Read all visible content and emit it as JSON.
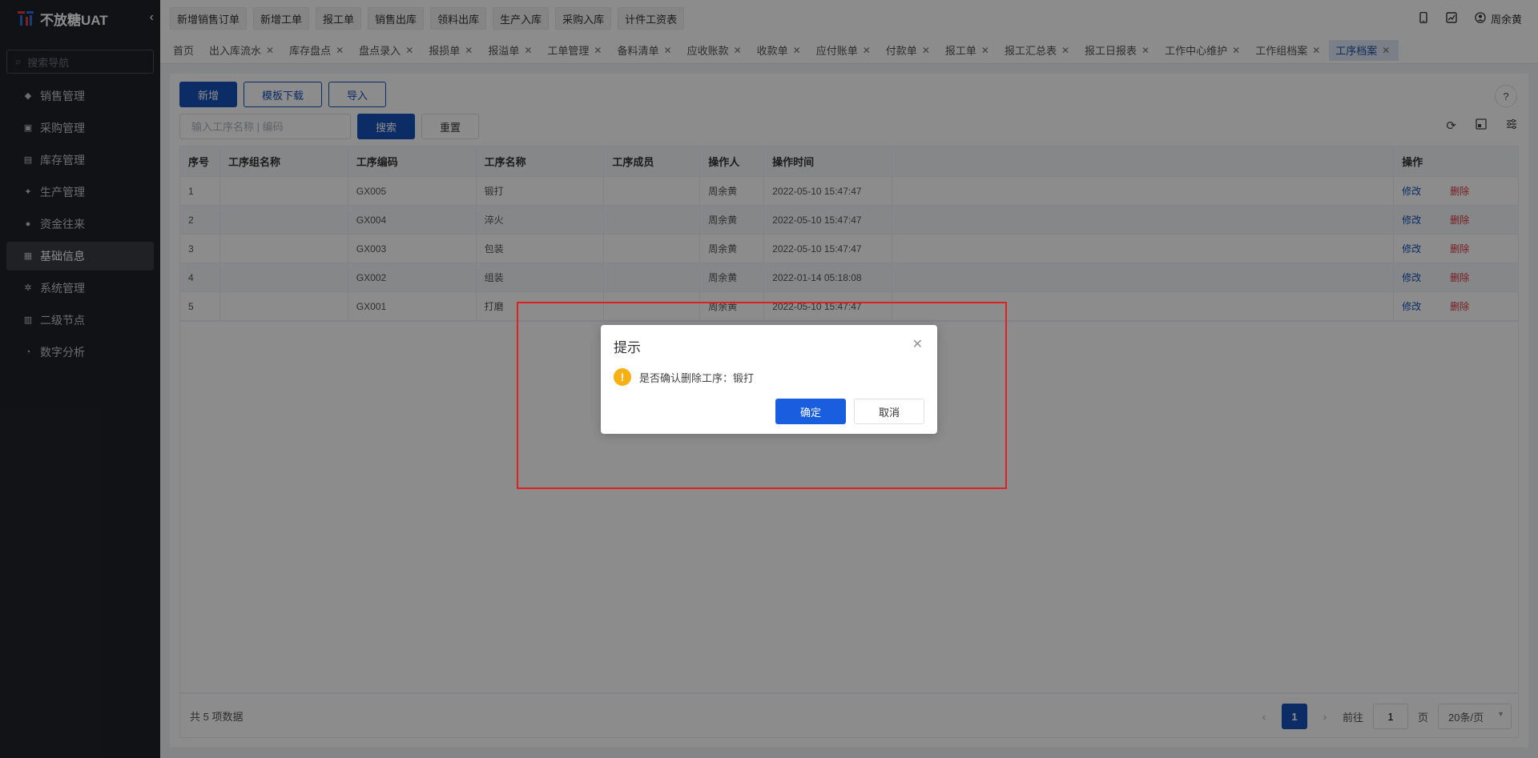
{
  "app": {
    "title": "不放糖UAT",
    "collapse_icon": "chevron-left-icon"
  },
  "sidebar": {
    "search_placeholder": "搜索导航",
    "items": [
      {
        "label": "销售管理",
        "icon": "tag-icon"
      },
      {
        "label": "采购管理",
        "icon": "cart-icon"
      },
      {
        "label": "库存管理",
        "icon": "warehouse-icon"
      },
      {
        "label": "生产管理",
        "icon": "production-icon"
      },
      {
        "label": "资金往来",
        "icon": "money-icon"
      },
      {
        "label": "基础信息",
        "icon": "grid-icon",
        "active": true
      },
      {
        "label": "系统管理",
        "icon": "settings-icon"
      },
      {
        "label": "二级节点",
        "icon": "document-icon"
      },
      {
        "label": "数字分析",
        "icon": "pie-chart-icon"
      }
    ]
  },
  "topbar": {
    "quick_buttons": [
      "新增销售订单",
      "新增工单",
      "报工单",
      "销售出库",
      "领料出库",
      "生产入库",
      "采购入库",
      "计件工资表"
    ],
    "user_name": "周余黄"
  },
  "tabs": [
    {
      "label": "首页",
      "closable": false
    },
    {
      "label": "出入库流水",
      "closable": true
    },
    {
      "label": "库存盘点",
      "closable": true
    },
    {
      "label": "盘点录入",
      "closable": true
    },
    {
      "label": "报损单",
      "closable": true
    },
    {
      "label": "报溢单",
      "closable": true
    },
    {
      "label": "工单管理",
      "closable": true
    },
    {
      "label": "备料清单",
      "closable": true
    },
    {
      "label": "应收账款",
      "closable": true
    },
    {
      "label": "收款单",
      "closable": true
    },
    {
      "label": "应付账单",
      "closable": true
    },
    {
      "label": "付款单",
      "closable": true
    },
    {
      "label": "报工单",
      "closable": true
    },
    {
      "label": "报工汇总表",
      "closable": true
    },
    {
      "label": "报工日报表",
      "closable": true
    },
    {
      "label": "工作中心维护",
      "closable": true
    },
    {
      "label": "工作组档案",
      "closable": true
    },
    {
      "label": "工序档案",
      "closable": true,
      "active": true
    }
  ],
  "toolbar": {
    "add_label": "新增",
    "template_label": "模板下载",
    "import_label": "导入",
    "search_placeholder": "输入工序名称 | 编码",
    "search_label": "搜索",
    "reset_label": "重置"
  },
  "table": {
    "headers": [
      "序号",
      "工序组名称",
      "工序编码",
      "工序名称",
      "工序成员",
      "操作人",
      "操作时间",
      "",
      "操作"
    ],
    "rows": [
      {
        "no": "1",
        "group": "",
        "code": "GX005",
        "name": "锻打",
        "members": "",
        "operator": "周余黄",
        "time": "2022-05-10 15:47:47"
      },
      {
        "no": "2",
        "group": "",
        "code": "GX004",
        "name": "淬火",
        "members": "",
        "operator": "周余黄",
        "time": "2022-05-10 15:47:47"
      },
      {
        "no": "3",
        "group": "",
        "code": "GX003",
        "name": "包装",
        "members": "",
        "operator": "周余黄",
        "time": "2022-05-10 15:47:47"
      },
      {
        "no": "4",
        "group": "",
        "code": "GX002",
        "name": "组装",
        "members": "",
        "operator": "周余黄",
        "time": "2022-01-14 05:18:08"
      },
      {
        "no": "5",
        "group": "",
        "code": "GX001",
        "name": "打磨",
        "members": "",
        "operator": "周余黄",
        "time": "2022-05-10 15:47:47"
      }
    ],
    "edit_label": "修改",
    "delete_label": "删除"
  },
  "footer": {
    "total_text": "共 5 项数据",
    "current_page": "1",
    "goto_label": "前往",
    "goto_value": "1",
    "page_unit": "页",
    "page_size": "20条/页"
  },
  "dialog": {
    "title": "提示",
    "message": "是否确认删除工序：锻打",
    "confirm_label": "确定",
    "cancel_label": "取消"
  },
  "colors": {
    "primary": "#1550b8",
    "danger": "#d9363e",
    "warning": "#f5b014",
    "sidebar_bg": "#1f2229",
    "highlight": "#e02020"
  }
}
